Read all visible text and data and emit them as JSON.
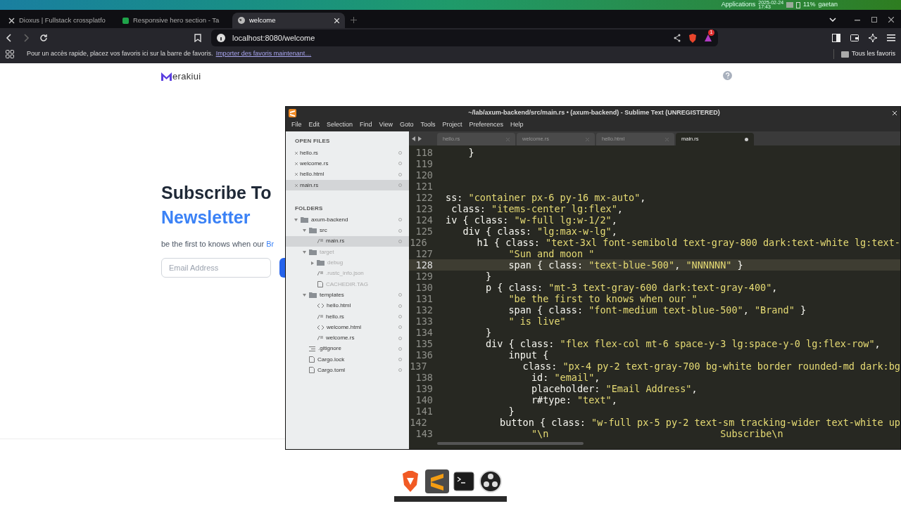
{
  "top_panel": {
    "apps": "Applications",
    "date": "2025-02-24",
    "time": "17:43",
    "battery": "11%",
    "user": "gaetan"
  },
  "browser": {
    "tabs": [
      {
        "label": "Dioxus | Fullstack crossplatfo",
        "selected": false,
        "kind": "x"
      },
      {
        "label": "Responsive hero section - Ta",
        "selected": false,
        "kind": "hero"
      },
      {
        "label": "welcome",
        "selected": true,
        "kind": "globe"
      }
    ],
    "url": "localhost:8080/welcome",
    "notification_count": "1",
    "bookmarks_hint": "Pour un accès rapide, placez vos favoris ici sur la barre de favoris.",
    "bookmarks_link": "Importer des favoris maintenant…",
    "all_bookmarks": "Tous les favoris"
  },
  "site": {
    "logo": "erakiui",
    "heading": "Subscribe To",
    "heading_accent": "Newsletter",
    "text": "be the first to knows when our ",
    "text_accent": "Br",
    "email_placeholder": "Email Address"
  },
  "editor": {
    "title": "~/lab/axum-backend/src/main.rs • (axum-backend) - Sublime Text (UNREGISTERED)",
    "menu": [
      "File",
      "Edit",
      "Selection",
      "Find",
      "View",
      "Goto",
      "Tools",
      "Project",
      "Preferences",
      "Help"
    ],
    "tabs": [
      {
        "label": "hello.rs",
        "selected": false,
        "dirty": false
      },
      {
        "label": "welcome.rs",
        "selected": false,
        "dirty": false
      },
      {
        "label": "hello.html",
        "selected": false,
        "dirty": false
      },
      {
        "label": "main.rs",
        "selected": true,
        "dirty": true
      }
    ],
    "open_files_title": "OPEN FILES",
    "open_files": [
      {
        "label": "hello.rs",
        "selected": false
      },
      {
        "label": "welcome.rs",
        "selected": false
      },
      {
        "label": "hello.html",
        "selected": false
      },
      {
        "label": "main.rs",
        "selected": true
      }
    ],
    "folders_title": "FOLDERS",
    "folders": [
      {
        "label": "axum-backend",
        "kind": "folder",
        "expanded": true,
        "dimmed": false,
        "selected": false,
        "children": [
          {
            "label": "src",
            "kind": "folder",
            "expanded": true,
            "dimmed": false,
            "selected": false,
            "children": [
              {
                "label": "main.rs",
                "kind": "code",
                "dimmed": false,
                "selected": true
              }
            ]
          },
          {
            "label": "target",
            "kind": "folder",
            "expanded": true,
            "dimmed": true,
            "selected": false,
            "children": [
              {
                "label": "debug",
                "kind": "folder",
                "expanded": false,
                "dimmed": true,
                "selected": false
              },
              {
                "label": ".rustc_info.json",
                "kind": "code",
                "dimmed": true,
                "selected": false
              },
              {
                "label": "CACHEDIR.TAG",
                "kind": "file",
                "dimmed": true,
                "selected": false
              }
            ]
          },
          {
            "label": "templates",
            "kind": "folder",
            "expanded": true,
            "dimmed": false,
            "selected": false,
            "children": [
              {
                "label": "hello.html",
                "kind": "html",
                "dimmed": false,
                "selected": false
              },
              {
                "label": "hello.rs",
                "kind": "code",
                "dimmed": false,
                "selected": false
              },
              {
                "label": "welcome.html",
                "kind": "html",
                "dimmed": false,
                "selected": false
              },
              {
                "label": "welcome.rs",
                "kind": "code",
                "dimmed": false,
                "selected": false
              }
            ]
          },
          {
            "label": ".gitignore",
            "kind": "list",
            "dimmed": false,
            "selected": false
          },
          {
            "label": "Cargo.lock",
            "kind": "file",
            "dimmed": false,
            "selected": false
          },
          {
            "label": "Cargo.toml",
            "kind": "file",
            "dimmed": false,
            "selected": false
          }
        ]
      }
    ],
    "lines": [
      {
        "number": "118",
        "code": "    }",
        "current": false
      },
      {
        "number": "119",
        "current": false
      },
      {
        "number": "120",
        "current": false
      },
      {
        "number": "121",
        "current": false
      },
      {
        "number": "122",
        "code": "ss: \"container px-6 py-16 mx-auto\",",
        "current": false
      },
      {
        "number": "123",
        "code": " class: \"items-center lg:flex\",",
        "current": false
      },
      {
        "number": "124",
        "code": "iv { class: \"w-full lg:w-1/2\",",
        "current": false
      },
      {
        "number": "125",
        "code": "   div { class: \"lg:max-w-lg\",",
        "current": false
      },
      {
        "number": "126",
        "code": "       h1 { class: \"text-3xl font-semibold text-gray-800 dark:text-white lg:text-",
        "current": false
      },
      {
        "number": "127",
        "code": "           \"Sun and moon \"",
        "current": false
      },
      {
        "number": "128",
        "code": "           span { class: \"text-blue-500\", \"NNNNNN\" }",
        "current": true
      },
      {
        "number": "129",
        "code": "       }",
        "current": false
      },
      {
        "number": "130",
        "code": "       p { class: \"mt-3 text-gray-600 dark:text-gray-400\",",
        "current": false
      },
      {
        "number": "131",
        "code": "           \"be the first to knows when our \"",
        "current": false
      },
      {
        "number": "132",
        "code": "           span { class: \"font-medium text-blue-500\", \"Brand\" }",
        "current": false
      },
      {
        "number": "133",
        "code": "           \" is live\"",
        "current": false
      },
      {
        "number": "134",
        "code": "       }",
        "current": false
      },
      {
        "number": "135",
        "code": "       div { class: \"flex flex-col mt-6 space-y-3 lg:space-y-0 lg:flex-row\",",
        "current": false
      },
      {
        "number": "136",
        "code": "           input {",
        "current": false
      },
      {
        "number": "137",
        "code": "               class: \"px-4 py-2 text-gray-700 bg-white border rounded-md dark:bg",
        "current": false
      },
      {
        "number": "138",
        "code": "               id: \"email\",",
        "current": false
      },
      {
        "number": "139",
        "code": "               placeholder: \"Email Address\",",
        "current": false
      },
      {
        "number": "140",
        "code": "               r#type: \"text\",",
        "current": false
      },
      {
        "number": "141",
        "code": "           }",
        "current": false
      },
      {
        "number": "142",
        "code": "           button { class: \"w-full px-5 py-2 text-sm tracking-wider text-white up",
        "current": false
      },
      {
        "number": "143",
        "code": "               \"\\n                              Subscribe\\n",
        "current": false
      }
    ]
  },
  "dock": [
    {
      "kind": "browser"
    },
    {
      "kind": "editor"
    },
    {
      "kind": "terminal"
    },
    {
      "kind": "recorder"
    }
  ]
}
